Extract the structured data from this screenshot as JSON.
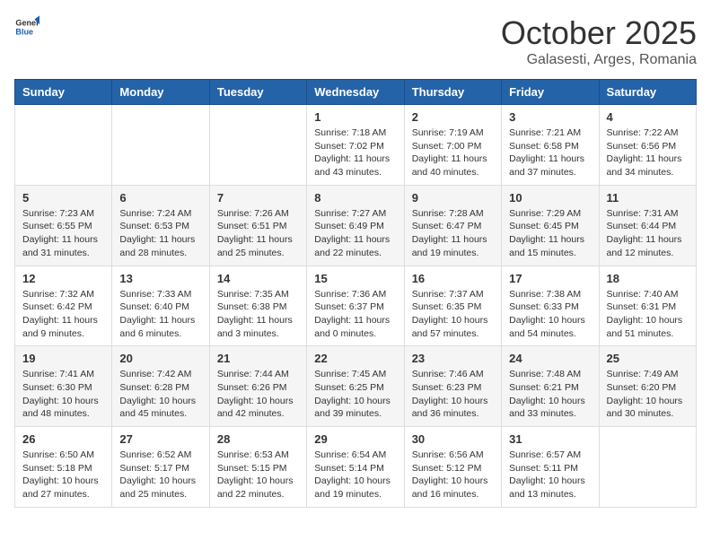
{
  "logo": {
    "text_general": "General",
    "text_blue": "Blue"
  },
  "header": {
    "month": "October 2025",
    "location": "Galasesti, Arges, Romania"
  },
  "weekdays": [
    "Sunday",
    "Monday",
    "Tuesday",
    "Wednesday",
    "Thursday",
    "Friday",
    "Saturday"
  ],
  "weeks": [
    [
      {
        "day": "",
        "info": ""
      },
      {
        "day": "",
        "info": ""
      },
      {
        "day": "",
        "info": ""
      },
      {
        "day": "1",
        "info": "Sunrise: 7:18 AM\nSunset: 7:02 PM\nDaylight: 11 hours and 43 minutes."
      },
      {
        "day": "2",
        "info": "Sunrise: 7:19 AM\nSunset: 7:00 PM\nDaylight: 11 hours and 40 minutes."
      },
      {
        "day": "3",
        "info": "Sunrise: 7:21 AM\nSunset: 6:58 PM\nDaylight: 11 hours and 37 minutes."
      },
      {
        "day": "4",
        "info": "Sunrise: 7:22 AM\nSunset: 6:56 PM\nDaylight: 11 hours and 34 minutes."
      }
    ],
    [
      {
        "day": "5",
        "info": "Sunrise: 7:23 AM\nSunset: 6:55 PM\nDaylight: 11 hours and 31 minutes."
      },
      {
        "day": "6",
        "info": "Sunrise: 7:24 AM\nSunset: 6:53 PM\nDaylight: 11 hours and 28 minutes."
      },
      {
        "day": "7",
        "info": "Sunrise: 7:26 AM\nSunset: 6:51 PM\nDaylight: 11 hours and 25 minutes."
      },
      {
        "day": "8",
        "info": "Sunrise: 7:27 AM\nSunset: 6:49 PM\nDaylight: 11 hours and 22 minutes."
      },
      {
        "day": "9",
        "info": "Sunrise: 7:28 AM\nSunset: 6:47 PM\nDaylight: 11 hours and 19 minutes."
      },
      {
        "day": "10",
        "info": "Sunrise: 7:29 AM\nSunset: 6:45 PM\nDaylight: 11 hours and 15 minutes."
      },
      {
        "day": "11",
        "info": "Sunrise: 7:31 AM\nSunset: 6:44 PM\nDaylight: 11 hours and 12 minutes."
      }
    ],
    [
      {
        "day": "12",
        "info": "Sunrise: 7:32 AM\nSunset: 6:42 PM\nDaylight: 11 hours and 9 minutes."
      },
      {
        "day": "13",
        "info": "Sunrise: 7:33 AM\nSunset: 6:40 PM\nDaylight: 11 hours and 6 minutes."
      },
      {
        "day": "14",
        "info": "Sunrise: 7:35 AM\nSunset: 6:38 PM\nDaylight: 11 hours and 3 minutes."
      },
      {
        "day": "15",
        "info": "Sunrise: 7:36 AM\nSunset: 6:37 PM\nDaylight: 11 hours and 0 minutes."
      },
      {
        "day": "16",
        "info": "Sunrise: 7:37 AM\nSunset: 6:35 PM\nDaylight: 10 hours and 57 minutes."
      },
      {
        "day": "17",
        "info": "Sunrise: 7:38 AM\nSunset: 6:33 PM\nDaylight: 10 hours and 54 minutes."
      },
      {
        "day": "18",
        "info": "Sunrise: 7:40 AM\nSunset: 6:31 PM\nDaylight: 10 hours and 51 minutes."
      }
    ],
    [
      {
        "day": "19",
        "info": "Sunrise: 7:41 AM\nSunset: 6:30 PM\nDaylight: 10 hours and 48 minutes."
      },
      {
        "day": "20",
        "info": "Sunrise: 7:42 AM\nSunset: 6:28 PM\nDaylight: 10 hours and 45 minutes."
      },
      {
        "day": "21",
        "info": "Sunrise: 7:44 AM\nSunset: 6:26 PM\nDaylight: 10 hours and 42 minutes."
      },
      {
        "day": "22",
        "info": "Sunrise: 7:45 AM\nSunset: 6:25 PM\nDaylight: 10 hours and 39 minutes."
      },
      {
        "day": "23",
        "info": "Sunrise: 7:46 AM\nSunset: 6:23 PM\nDaylight: 10 hours and 36 minutes."
      },
      {
        "day": "24",
        "info": "Sunrise: 7:48 AM\nSunset: 6:21 PM\nDaylight: 10 hours and 33 minutes."
      },
      {
        "day": "25",
        "info": "Sunrise: 7:49 AM\nSunset: 6:20 PM\nDaylight: 10 hours and 30 minutes."
      }
    ],
    [
      {
        "day": "26",
        "info": "Sunrise: 6:50 AM\nSunset: 5:18 PM\nDaylight: 10 hours and 27 minutes."
      },
      {
        "day": "27",
        "info": "Sunrise: 6:52 AM\nSunset: 5:17 PM\nDaylight: 10 hours and 25 minutes."
      },
      {
        "day": "28",
        "info": "Sunrise: 6:53 AM\nSunset: 5:15 PM\nDaylight: 10 hours and 22 minutes."
      },
      {
        "day": "29",
        "info": "Sunrise: 6:54 AM\nSunset: 5:14 PM\nDaylight: 10 hours and 19 minutes."
      },
      {
        "day": "30",
        "info": "Sunrise: 6:56 AM\nSunset: 5:12 PM\nDaylight: 10 hours and 16 minutes."
      },
      {
        "day": "31",
        "info": "Sunrise: 6:57 AM\nSunset: 5:11 PM\nDaylight: 10 hours and 13 minutes."
      },
      {
        "day": "",
        "info": ""
      }
    ]
  ]
}
